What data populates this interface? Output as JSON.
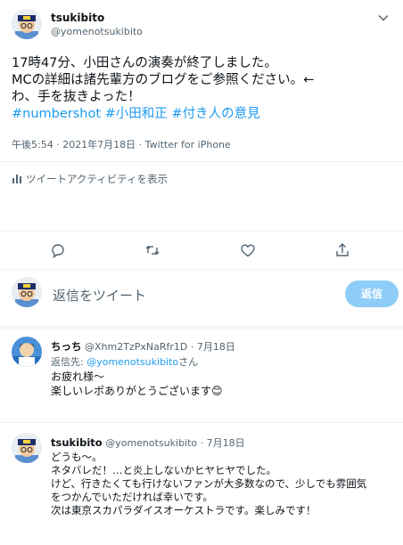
{
  "main_tweet": {
    "author_name": "tsukibito",
    "author_handle": "@yomenotsukibito",
    "text_line1": "17時47分、小田さんの演奏が終了しました。",
    "text_line2": "MCの詳細は諸先輩方のブログをご参照ください。←",
    "text_line3": "わ、手を抜きよった！",
    "hashtags": [
      "#numbershot",
      "#小田和正",
      "#付き人の意見"
    ],
    "meta": "午後5:54 · 2021年7月18日 · Twitter for iPhone",
    "activity_label": "ツイートアクティビティを表示"
  },
  "reply_box": {
    "placeholder": "返信をツイート",
    "button_label": "返信"
  },
  "replies": [
    {
      "author_name": "ちっち",
      "author_handle": "@Xhm2TzPxNaRfr1D",
      "date": "7月18日",
      "reply_to_prefix": "返信先: ",
      "reply_to_handle": "@yomenotsukibito",
      "reply_to_suffix": "さん",
      "lines": [
        "お疲れ様～",
        "楽しいレポありがとうございます😊"
      ]
    },
    {
      "author_name": "tsukibito",
      "author_handle": "@yomenotsukibito",
      "date": "7月18日",
      "lines": [
        "どうも～。",
        "ネタバレだ！…と炎上しないかヒヤヒヤでした。",
        "けど、行きたくても行けないファンが大多数なので、少しでも雰囲気",
        "をつかんでいただければ幸いです。",
        "次は東京スカパラダイスオーケストラです。楽しみです！"
      ]
    }
  ],
  "colors": {
    "accent": "#1d9bf0",
    "muted": "#536471",
    "divider": "#eff3f4"
  },
  "icons": [
    "chevron-down-icon",
    "stats-icon",
    "reply-icon",
    "retweet-icon",
    "like-icon",
    "share-icon"
  ]
}
